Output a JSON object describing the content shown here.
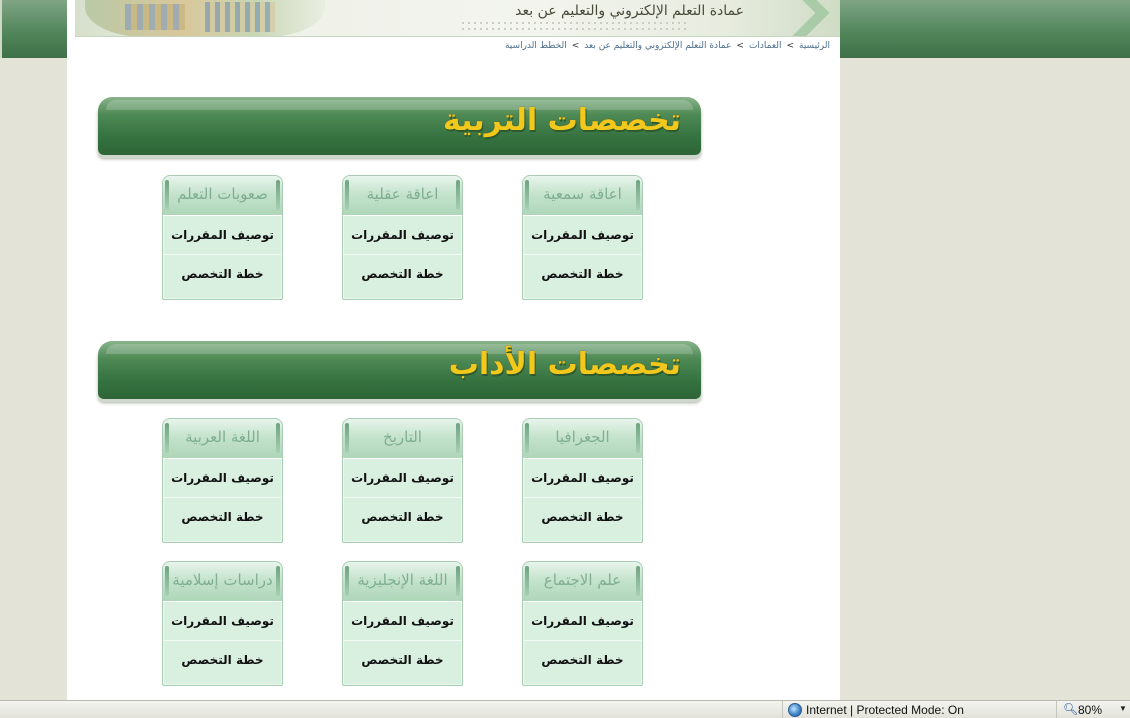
{
  "header": {
    "title": "عمادة التعلم الإلكتروني والتعليم عن بعد"
  },
  "breadcrumb": {
    "items": [
      "الرئيسية",
      "العمادات",
      "عمادة التعلم الإلكتروني والتعليم عن بعد",
      "الخطط الدراسية"
    ],
    "separator": ">"
  },
  "sections": [
    {
      "title": "تخصصات التربية",
      "cards": [
        {
          "title": "اعاقة سمعية",
          "links": [
            "توصيف المقررات",
            "خطة التخصص"
          ]
        },
        {
          "title": "اعاقة عقلية",
          "links": [
            "توصيف المقررات",
            "خطة التخصص"
          ]
        },
        {
          "title": "صعوبات التعلم",
          "links": [
            "توصيف المقررات",
            "خطة التخصص"
          ]
        }
      ]
    },
    {
      "title": "تخصصات الأداب",
      "cards": [
        {
          "title": "الجغرافيا",
          "links": [
            "توصيف المقررات",
            "خطة التخصص"
          ]
        },
        {
          "title": "التاريخ",
          "links": [
            "توصيف المقررات",
            "خطة التخصص"
          ]
        },
        {
          "title": "اللغة العربية",
          "links": [
            "توصيف المقررات",
            "خطة التخصص"
          ]
        },
        {
          "title": "علم الاجتماع",
          "links": [
            "توصيف المقررات",
            "خطة التخصص"
          ]
        },
        {
          "title": "اللغة الإنجليزية",
          "links": [
            "توصيف المقررات",
            "خطة التخصص"
          ]
        },
        {
          "title": "دراسات إسلامية",
          "links": [
            "توصيف المقررات",
            "خطة التخصص"
          ]
        }
      ]
    }
  ],
  "statusbar": {
    "zone": "Internet | Protected Mode: On",
    "zoom": "80%",
    "zone_icon": "globe-icon",
    "zoom_icon": "magnifier-icon"
  },
  "colors": {
    "section_bar": "#357240",
    "section_title": "#f2c81d",
    "card_bg": "#d9efe0",
    "card_title": "#7fae93",
    "page_bg": "#e3e4d7"
  }
}
